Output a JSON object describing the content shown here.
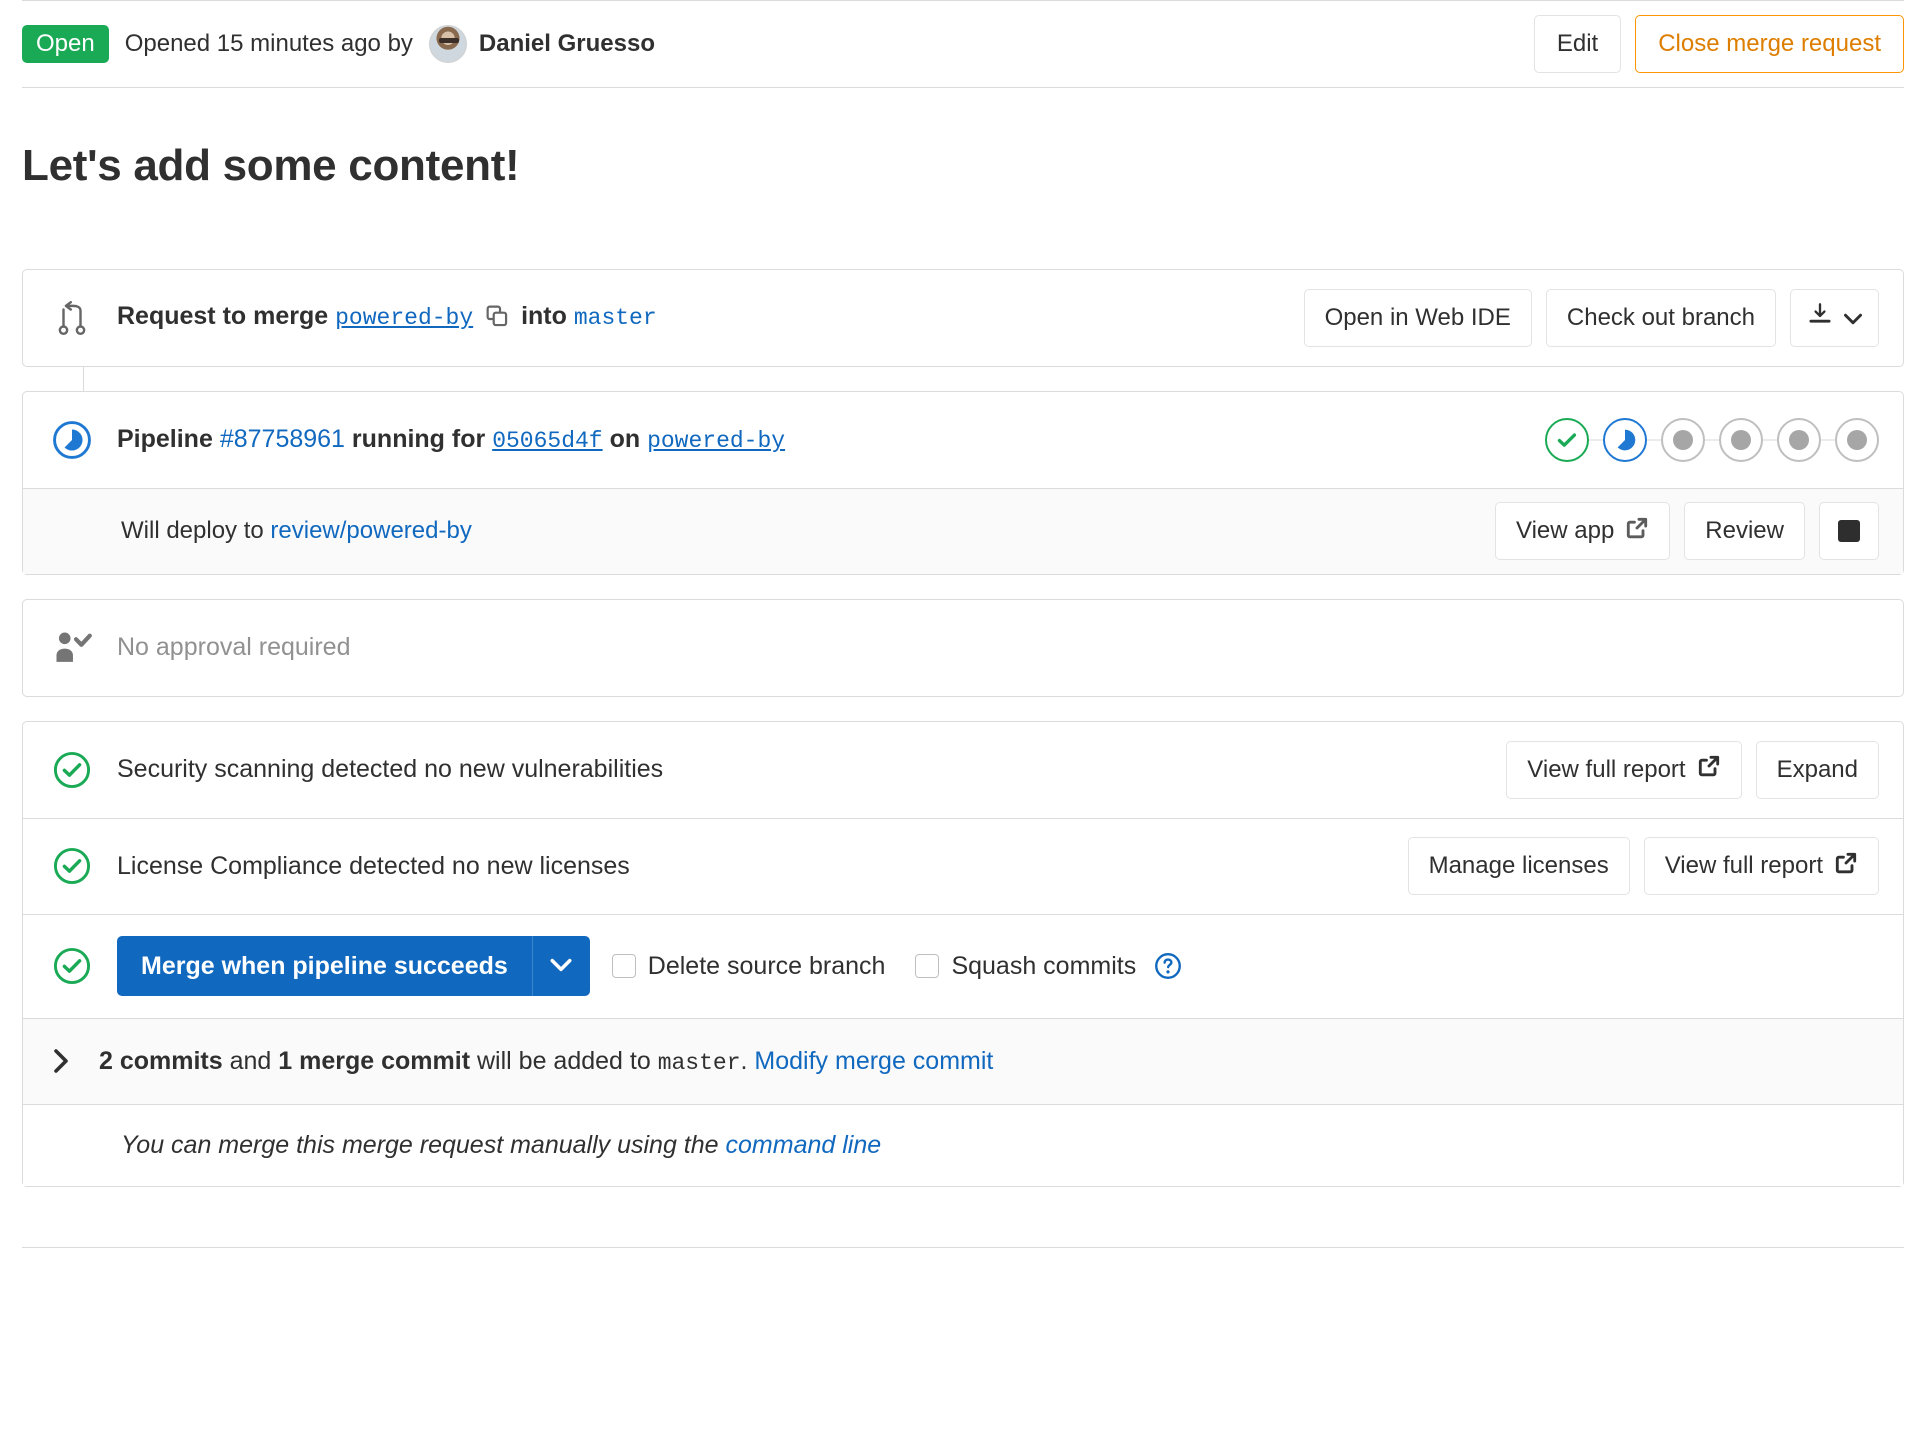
{
  "status_bar": {
    "state_badge": "Open",
    "opened_text": "Opened 15 minutes ago by",
    "author": "Daniel Gruesso",
    "edit_label": "Edit",
    "close_label": "Close merge request"
  },
  "title": "Let's add some content!",
  "merge_header": {
    "request_prefix": "Request to merge",
    "source_branch": "powered-by",
    "into": "into",
    "target_branch": "master",
    "copy_icon": "copy-icon",
    "web_ide_label": "Open in Web IDE",
    "checkout_label": "Check out branch",
    "download_icon": "download-icon",
    "download_caret": "chevron-down-icon"
  },
  "pipeline": {
    "status_icon": "running-icon",
    "prefix": "Pipeline",
    "id": "#87758961",
    "state": "running for",
    "commit_sha": "05065d4f",
    "on": "on",
    "branch": "powered-by",
    "stages": [
      {
        "state": "success",
        "name": "stage-status-success"
      },
      {
        "state": "running",
        "name": "stage-status-running"
      },
      {
        "state": "pending",
        "name": "stage-status-pending"
      },
      {
        "state": "pending",
        "name": "stage-status-pending"
      },
      {
        "state": "pending",
        "name": "stage-status-pending"
      },
      {
        "state": "pending",
        "name": "stage-status-pending"
      }
    ],
    "deploy_prefix": "Will deploy to",
    "deploy_env": "review/powered-by",
    "view_app_label": "View app",
    "review_label": "Review",
    "stop_icon": "stop-icon"
  },
  "approval": {
    "icon": "user-check-icon",
    "text": "No approval required"
  },
  "security": {
    "icon": "check-circle-icon",
    "text": "Security scanning detected no new vulnerabilities",
    "view_report_label": "View full report",
    "expand_label": "Expand"
  },
  "license": {
    "icon": "check-circle-icon",
    "text": "License Compliance detected no new licenses",
    "manage_label": "Manage licenses",
    "view_report_label": "View full report"
  },
  "merge": {
    "icon": "check-circle-icon",
    "button_label": "Merge when pipeline succeeds",
    "dropdown_icon": "chevron-down-icon",
    "delete_branch_label": "Delete source branch",
    "squash_label": "Squash commits",
    "help_icon": "question-circle-icon",
    "delete_branch_checked": false,
    "squash_checked": false
  },
  "commits_summary": {
    "expand_icon": "chevron-right-icon",
    "commits_count": "2 commits",
    "and": "and",
    "merge_commit_count": "1 merge commit",
    "suffix": "will be added to",
    "target_branch": "master",
    "period": ".",
    "modify_link": "Modify merge commit"
  },
  "manual_merge": {
    "text": "You can merge this merge request manually using the",
    "link": "command line"
  },
  "colors": {
    "open_green": "#1aaa55",
    "warning_orange": "#fc9403",
    "link_blue": "#1068bf",
    "running_blue": "#1f78d1",
    "pending_gray": "#a6a6a6"
  }
}
